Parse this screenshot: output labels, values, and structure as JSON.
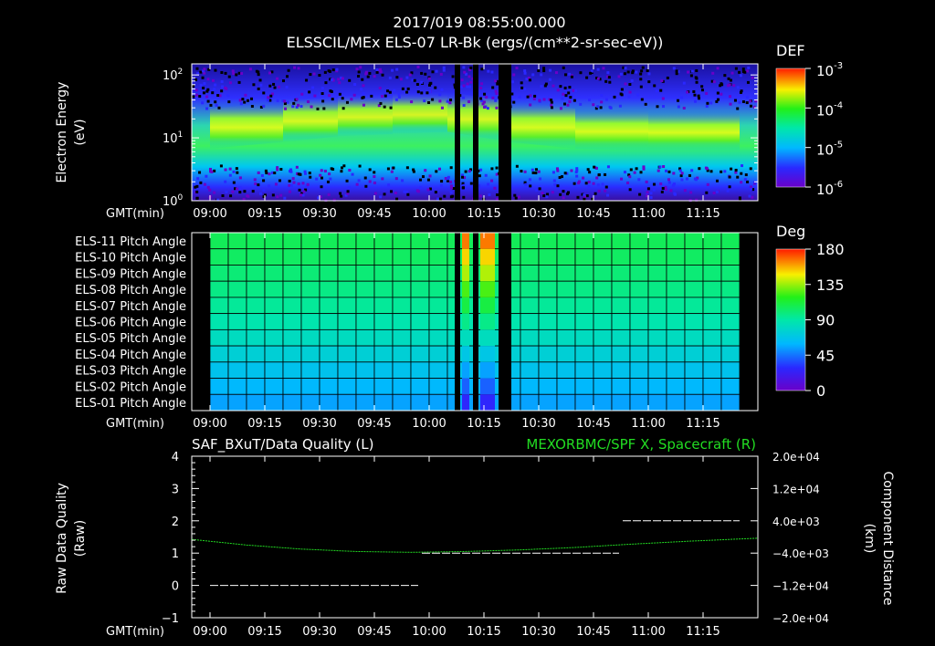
{
  "header": {
    "timestamp": "2017/019 08:55:00.000",
    "title": "ELSSCIL/MEx ELS-07 LR-Bk  (ergs/(cm**2-sr-sec-eV))"
  },
  "colors": {
    "background": "#000000",
    "foreground": "#ffffff",
    "spacecraft_line": "#22dd22",
    "quality_line": "#ffffff"
  },
  "chart_data": [
    {
      "type": "heatmap",
      "name": "energy-spectrogram",
      "ylabel": "Electron Energy\n(eV)",
      "ylabel_lines": [
        "Electron Energy",
        "(eV)"
      ],
      "yscale": "log",
      "ylim": [
        1,
        150
      ],
      "ytick_bases": [
        "10",
        "10",
        "10"
      ],
      "ytick_exps": [
        "0",
        "1",
        "2"
      ],
      "ytick_values": [
        1,
        10,
        100
      ],
      "xlabel": "GMT(min)",
      "xticks": [
        "09:00",
        "09:15",
        "09:30",
        "09:45",
        "10:00",
        "10:15",
        "10:30",
        "10:45",
        "11:00",
        "11:15"
      ],
      "xtick_minutes": [
        540,
        555,
        570,
        585,
        600,
        615,
        630,
        645,
        660,
        675
      ],
      "xlim_minutes": [
        535,
        690
      ],
      "data_gaps_minutes": [
        [
          607,
          608.5
        ],
        [
          612,
          613.5
        ],
        [
          619,
          622.5
        ]
      ],
      "colorbar": {
        "label": "DEF",
        "tick_bases": [
          "10",
          "10",
          "10",
          "10"
        ],
        "tick_exps": [
          "-3",
          "-4",
          "-5",
          "-6"
        ],
        "range": [
          1e-06,
          0.001
        ],
        "scale": "log"
      }
    },
    {
      "type": "heatmap",
      "name": "pitch-angle",
      "rows": [
        "ELS-11 Pitch Angle",
        "ELS-10 Pitch Angle",
        "ELS-09 Pitch Angle",
        "ELS-08 Pitch Angle",
        "ELS-07 Pitch Angle",
        "ELS-06 Pitch Angle",
        "ELS-05 Pitch Angle",
        "ELS-04 Pitch Angle",
        "ELS-03 Pitch Angle",
        "ELS-02 Pitch Angle",
        "ELS-01 Pitch Angle"
      ],
      "row_values_deg": [
        106,
        104,
        100,
        97,
        93,
        88,
        82,
        74,
        66,
        60,
        55
      ],
      "xlabel": "GMT(min)",
      "xticks": [
        "09:00",
        "09:15",
        "09:30",
        "09:45",
        "10:00",
        "10:15",
        "10:30",
        "10:45",
        "11:00",
        "11:15"
      ],
      "xlim_minutes": [
        535,
        690
      ],
      "data_start_minutes": [
        540,
        685
      ],
      "data_gaps_minutes": [
        [
          607,
          608.5
        ],
        [
          612,
          613.5
        ],
        [
          619,
          622.5
        ]
      ],
      "colorbar": {
        "label": "Deg",
        "ticks": [
          "180",
          "135",
          "90",
          "45",
          "0"
        ],
        "range": [
          0,
          180
        ]
      }
    },
    {
      "type": "line",
      "name": "data-quality",
      "title_left": "SAF_BXuT/Data Quality (L)",
      "title_right": "MEXORBMC/SPF X, Spacecraft (R)",
      "ylabel_left": "Raw Data Quality\n(Raw)",
      "ylabel_left_lines": [
        "Raw Data Quality",
        "(Raw)"
      ],
      "ylabel_right": "Component Distance\n(km)",
      "ylabel_right_lines": [
        "Component Distance",
        "(km)"
      ],
      "yticks_left": [
        "4",
        "3",
        "2",
        "1",
        "0",
        "−1"
      ],
      "ylim_left": [
        -1,
        4
      ],
      "yticks_right": [
        "2.0e+04",
        "1.2e+04",
        "4.0e+03",
        "−4.0e+03",
        "−1.2e+04",
        "−2.0e+04"
      ],
      "ylim_right": [
        -20000,
        20000
      ],
      "xlabel": "GMT(min)",
      "xticks": [
        "09:00",
        "09:15",
        "09:30",
        "09:45",
        "10:00",
        "10:15",
        "10:30",
        "10:45",
        "11:00",
        "11:15"
      ],
      "xlim_minutes": [
        535,
        690
      ],
      "series": [
        {
          "name": "SAF_BXuT/Data Quality",
          "axis": "left",
          "segments": [
            {
              "x": [
                540,
                597
              ],
              "y": 0
            },
            {
              "x": [
                598,
                652
              ],
              "y": 1
            },
            {
              "x": [
                653,
                685
              ],
              "y": 2
            }
          ]
        },
        {
          "name": "MEXORBMC/SPF X, Spacecraft",
          "axis": "right",
          "x": [
            535,
            550,
            565,
            580,
            595,
            610,
            625,
            640,
            655,
            670,
            690
          ],
          "y": [
            -600,
            -2000,
            -3000,
            -3600,
            -3800,
            -3600,
            -3200,
            -2600,
            -1800,
            -1100,
            -300
          ]
        }
      ]
    }
  ]
}
